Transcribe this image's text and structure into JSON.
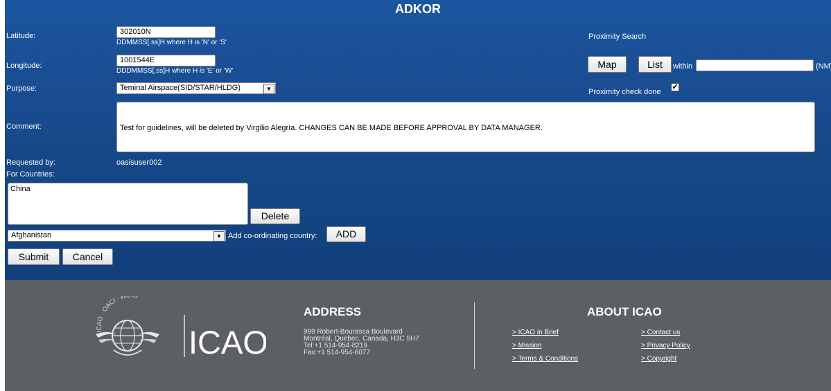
{
  "page": {
    "title": "ADKOR"
  },
  "form": {
    "latitude": {
      "label": "Latitude:",
      "value": "302010N",
      "hint": "DDMMSS[.ss]H where H is 'N' or 'S'"
    },
    "longitude": {
      "label": "Longitude:",
      "value": "1001544E",
      "hint": "DDDMMSS[.ss]H where H is 'E' or 'W'"
    },
    "purpose": {
      "label": "Purpose:",
      "value": "Teminal Airspace(SID/STAR/HLDG)"
    },
    "comment": {
      "label": "Comment:",
      "value": "Test for guidelines, will be deleted by Virgilio Alegría. CHANGES CAN BE MADE BEFORE APPROVAL BY DATA MANAGER."
    },
    "requested_by": {
      "label": "Requested by:",
      "value": "oasisuser002"
    },
    "for_countries": {
      "label": "For Countries:",
      "items": [
        "China"
      ]
    },
    "delete_label": "Delete",
    "country_select": {
      "value": "Afghanistan"
    },
    "add_coord_label": "Add co-ordinating country:",
    "add_label": "ADD",
    "submit_label": "Submit",
    "cancel_label": "Cancel"
  },
  "proximity": {
    "heading": "Proximity Search",
    "map_label": "Map",
    "list_label": "List",
    "within_label": "within",
    "within_value": "",
    "unit": "(NM)",
    "check_label": "Proximity check done",
    "checked": true
  },
  "footer": {
    "logo_text": "ICAO",
    "logo_arc_text": "ICAO · OACI · ИКАО",
    "address": {
      "heading": "ADDRESS",
      "lines": [
        "999 Robert-Bourassa Boulevard",
        "Montréal, Quebec, Canada, H3C 5H7",
        "Tel:+1 514-954-8219",
        "Fax:+1 514-954-6077"
      ]
    },
    "about": {
      "heading": "ABOUT ICAO",
      "left_links": [
        "> ICAO in Brief",
        "> Mission",
        "> Terms & Conditions"
      ],
      "right_links": [
        "> Contact us",
        "> Privacy Policy",
        "> Copyright"
      ]
    }
  },
  "colors": {
    "main_bg": "#1a4d92",
    "footer_bg": "#5c5f63"
  }
}
